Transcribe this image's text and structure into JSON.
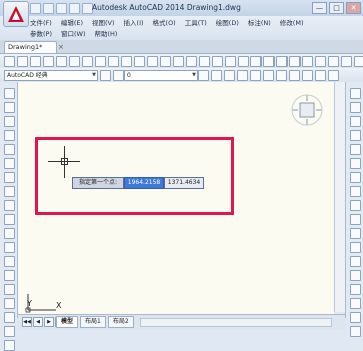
{
  "window": {
    "title": "Autodesk AutoCAD 2014    Drawing1.dwg",
    "minimize": "—",
    "maximize": "□",
    "close": "✕"
  },
  "menu": {
    "row1": [
      "文件(F)",
      "编辑(E)",
      "视图(V)",
      "插入(I)",
      "格式(O)",
      "工具(T)",
      "绘图(D)",
      "标注(N)",
      "修改(M)"
    ],
    "row2": [
      "参数(P)",
      "窗口(W)",
      "帮助(H)"
    ]
  },
  "document_tab": {
    "label": "Drawing1*",
    "close": "×"
  },
  "toolbar": {
    "workspace": "AutoCAD 经典",
    "layer": "0"
  },
  "drawing": {
    "prompt": "指定第一个点:",
    "coord_x": "1964.2158",
    "coord_y": "1371.4634"
  },
  "ucs": {
    "x_label": "X",
    "y_label": "Y"
  },
  "layout_tabs": {
    "nav": [
      "◀◀",
      "◀",
      "▶",
      "▶▶"
    ],
    "tabs": [
      {
        "label": "模型",
        "active": true
      },
      {
        "label": "布局1",
        "active": false
      },
      {
        "label": "布局2",
        "active": false
      }
    ]
  },
  "colors": {
    "highlight": "#e0164f",
    "canvas": "#fbfbf2",
    "coord_active": "#3f78d6"
  }
}
